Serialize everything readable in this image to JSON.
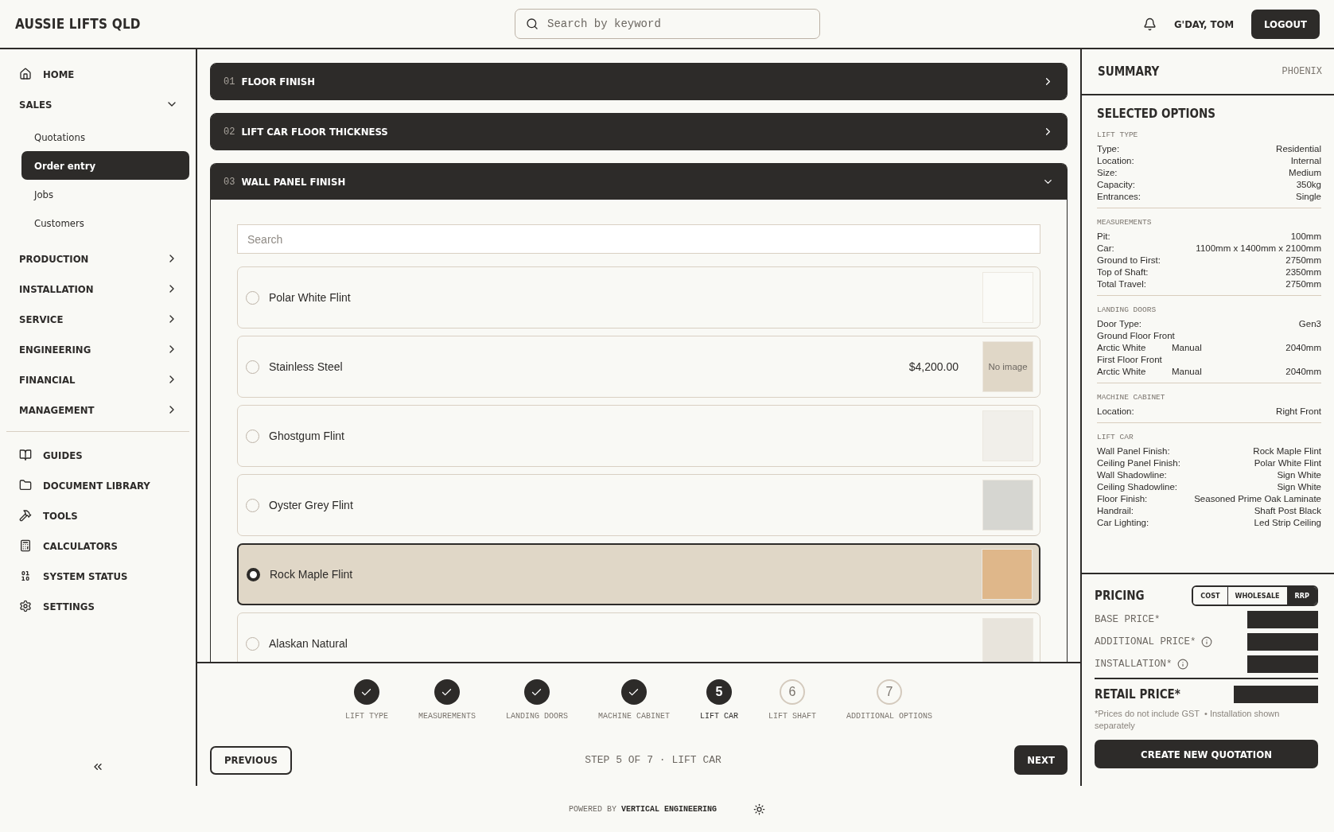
{
  "header": {
    "brand": "AUSSIE LIFTS QLD",
    "search": {
      "placeholder": "Search by keyword"
    },
    "greeting": "G'DAY, TOM",
    "logout": "LOGOUT"
  },
  "sidebar": {
    "nav": [
      {
        "label": "HOME",
        "kind": "link"
      },
      {
        "label": "SALES",
        "kind": "group",
        "expanded": true,
        "children": [
          {
            "label": "Quotations",
            "selected": false
          },
          {
            "label": "Order entry",
            "selected": true
          },
          {
            "label": "Jobs",
            "selected": false
          },
          {
            "label": "Customers",
            "selected": false
          }
        ]
      },
      {
        "label": "PRODUCTION",
        "kind": "group",
        "expanded": false
      },
      {
        "label": "INSTALLATION",
        "kind": "group",
        "expanded": false
      },
      {
        "label": "SERVICE",
        "kind": "group",
        "expanded": false
      },
      {
        "label": "ENGINEERING",
        "kind": "group",
        "expanded": false
      },
      {
        "label": "FINANCIAL",
        "kind": "group",
        "expanded": false
      },
      {
        "label": "MANAGEMENT",
        "kind": "group",
        "expanded": false
      }
    ],
    "tools": [
      {
        "label": "GUIDES"
      },
      {
        "label": "DOCUMENT LIBRARY"
      },
      {
        "label": "TOOLS"
      },
      {
        "label": "CALCULATORS"
      },
      {
        "label": "SYSTEM STATUS"
      },
      {
        "label": "SETTINGS"
      }
    ]
  },
  "accordion": [
    {
      "number": "01",
      "title": "FLOOR FINISH",
      "expanded": false
    },
    {
      "number": "02",
      "title": "LIFT CAR FLOOR THICKNESS",
      "expanded": false
    },
    {
      "number": "03",
      "title": "WALL PANEL FINISH",
      "expanded": true,
      "search": {
        "placeholder": "Search"
      },
      "options": [
        {
          "name": "Polar White Flint",
          "selected": false,
          "kind": "swatch",
          "color": "#fbfbf8"
        },
        {
          "name": "Stainless Steel",
          "selected": false,
          "kind": "no-image",
          "price": "$4,200.00",
          "swatch_text": "No image"
        },
        {
          "name": "Ghostgum Flint",
          "selected": false,
          "kind": "swatch",
          "color": "#f1efea"
        },
        {
          "name": "Oyster Grey Flint",
          "selected": false,
          "kind": "swatch",
          "color": "#d6d6d1"
        },
        {
          "name": "Rock Maple Flint",
          "selected": true,
          "kind": "swatch",
          "color": "#dfb78a"
        },
        {
          "name": "Alaskan Natural",
          "selected": false,
          "kind": "swatch",
          "color": "#e8e4dc"
        }
      ]
    }
  ],
  "stepper": {
    "steps": [
      {
        "label": "LIFT TYPE",
        "completed": true,
        "current": false
      },
      {
        "label": "MEASUREMENTS",
        "completed": true,
        "current": false
      },
      {
        "label": "LANDING DOORS",
        "completed": true,
        "current": false
      },
      {
        "label": "MACHINE CABINET",
        "completed": true,
        "current": false
      },
      {
        "label": "LIFT CAR",
        "completed": false,
        "current": true,
        "number": "5"
      },
      {
        "label": "LIFT SHAFT",
        "completed": false,
        "current": false,
        "number": "6"
      },
      {
        "label": "ADDITIONAL OPTIONS",
        "completed": false,
        "current": false,
        "number": "7"
      }
    ],
    "previous": "PREVIOUS",
    "status": "STEP 5 OF 7 · LIFT CAR",
    "next": "NEXT"
  },
  "summary": {
    "title": "SUMMARY",
    "model": "PHOENIX",
    "selected_title": "SELECTED OPTIONS",
    "groups": [
      {
        "title": "LIFT TYPE",
        "rows": [
          {
            "cells": [
              "Type:",
              "Residential"
            ]
          },
          {
            "cells": [
              "Location:",
              "Internal"
            ]
          },
          {
            "cells": [
              "Size:",
              "Medium"
            ]
          },
          {
            "cells": [
              "Capacity:",
              "350kg"
            ]
          },
          {
            "cells": [
              "Entrances:",
              "Single"
            ]
          }
        ]
      },
      {
        "title": "MEASUREMENTS",
        "rows": [
          {
            "cells": [
              "Pit:",
              "100mm"
            ]
          },
          {
            "cells": [
              "Car:",
              "1100mm x 1400mm x 2100mm"
            ]
          },
          {
            "cells": [
              "Ground to First:",
              "2750mm"
            ]
          },
          {
            "cells": [
              "Top of Shaft:",
              "2350mm"
            ]
          },
          {
            "cells": [
              "Total Travel:",
              "2750mm"
            ]
          }
        ]
      },
      {
        "title": "LANDING DOORS",
        "rows": [
          {
            "cells": [
              "Door Type:",
              "",
              "Gen3"
            ]
          },
          {
            "cells": [
              "Ground Floor Front"
            ]
          },
          {
            "cells": [
              "Arctic White",
              "Manual",
              "2040mm"
            ]
          },
          {
            "cells": [
              "First Floor Front"
            ]
          },
          {
            "cells": [
              "Arctic White",
              "Manual",
              "2040mm"
            ]
          }
        ]
      },
      {
        "title": "MACHINE CABINET",
        "rows": [
          {
            "cells": [
              "Location:",
              "Right Front"
            ]
          }
        ]
      },
      {
        "title": "LIFT CAR",
        "rows": [
          {
            "cells": [
              "Wall Panel Finish:",
              "Rock Maple Flint"
            ]
          },
          {
            "cells": [
              "Ceiling Panel Finish:",
              "Polar White Flint"
            ]
          },
          {
            "cells": [
              "Wall Shadowline:",
              "Sign White"
            ]
          },
          {
            "cells": [
              "Ceiling Shadowline:",
              "Sign White"
            ]
          },
          {
            "cells": [
              "Floor Finish:",
              "Seasoned Prime Oak Laminate"
            ]
          },
          {
            "cells": [
              "Handrail:",
              "Shaft Post Black"
            ]
          },
          {
            "cells": [
              "Car Lighting:",
              "Led Strip Ceiling"
            ]
          }
        ]
      }
    ]
  },
  "pricing": {
    "title": "PRICING",
    "modes": [
      {
        "label": "COST",
        "selected": false
      },
      {
        "label": "WHOLESALE",
        "selected": false
      },
      {
        "label": "RRP",
        "selected": true
      }
    ],
    "rows": [
      {
        "label": "BASE PRICE*",
        "info": false
      },
      {
        "label": "ADDITIONAL PRICE*",
        "info": true
      },
      {
        "label": "INSTALLATION*",
        "info": true
      }
    ],
    "total": "RETAIL PRICE*",
    "note": "*Prices do not include GST  • Installation shown separately",
    "action": "CREATE NEW QUOTATION"
  },
  "footer": {
    "credit": "POWERED BY **VERTICAL ENGINEERING**"
  }
}
